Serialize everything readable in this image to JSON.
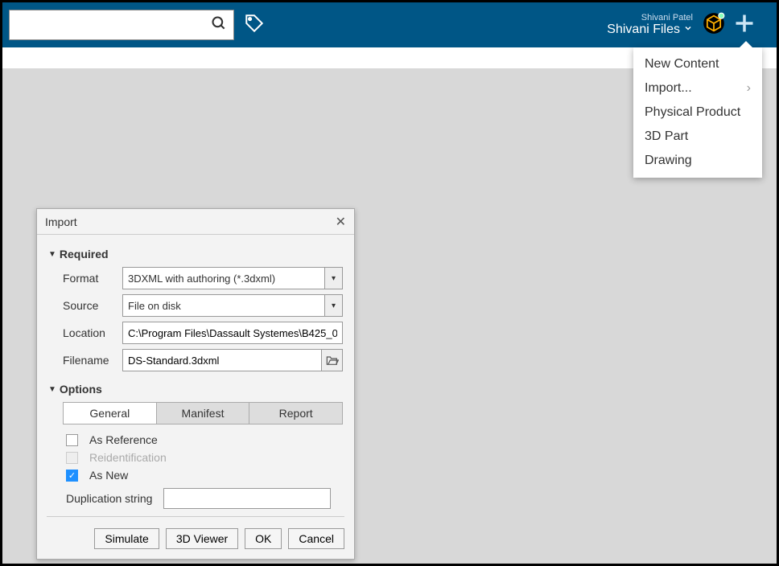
{
  "header": {
    "search_placeholder": "",
    "user_name": "Shivani Patel",
    "user_context": "Shivani Files"
  },
  "menu": {
    "items": [
      {
        "label": "New Content",
        "submenu": false
      },
      {
        "label": "Import...",
        "submenu": true
      },
      {
        "label": "Physical Product",
        "submenu": false
      },
      {
        "label": "3D Part",
        "submenu": false
      },
      {
        "label": "Drawing",
        "submenu": false
      }
    ]
  },
  "dialog": {
    "title": "Import",
    "sections": {
      "required": {
        "header": "Required",
        "format_label": "Format",
        "format_value": "3DXML with authoring (*.3dxml)",
        "source_label": "Source",
        "source_value": "File on disk",
        "location_label": "Location",
        "location_value": "C:\\Program Files\\Dassault Systemes\\B425_0",
        "filename_label": "Filename",
        "filename_value": "DS-Standard.3dxml"
      },
      "options": {
        "header": "Options",
        "tabs": [
          "General",
          "Manifest",
          "Report"
        ],
        "active_tab": 0,
        "as_reference": {
          "label": "As Reference",
          "checked": false
        },
        "reidentification": {
          "label": "Reidentification",
          "checked": false,
          "disabled": true
        },
        "as_new": {
          "label": "As New",
          "checked": true
        },
        "duplication_label": "Duplication string",
        "duplication_value": ""
      }
    },
    "buttons": {
      "simulate": "Simulate",
      "viewer": "3D Viewer",
      "ok": "OK",
      "cancel": "Cancel"
    }
  }
}
